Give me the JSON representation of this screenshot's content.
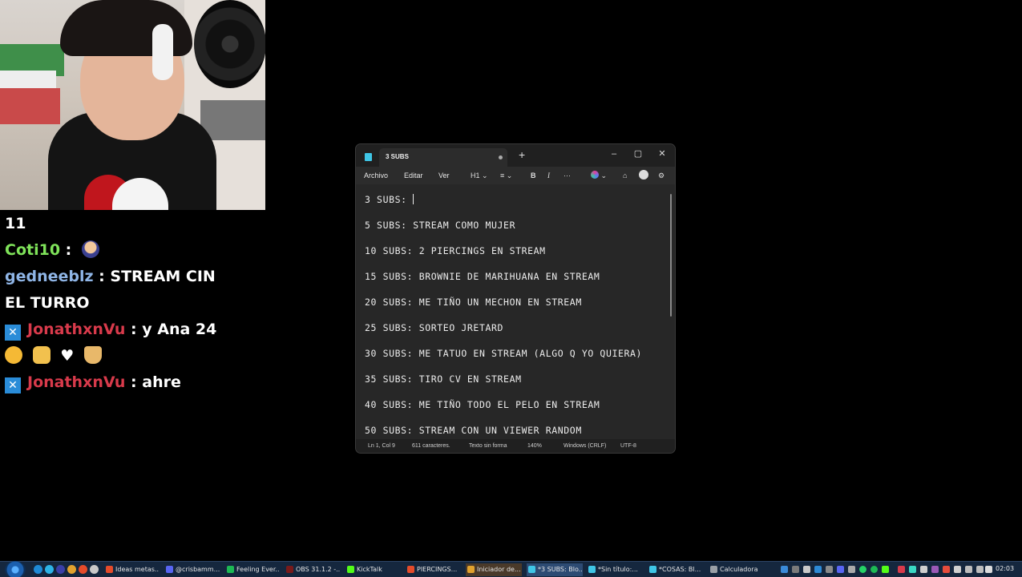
{
  "chat": {
    "lines": [
      {
        "text": "11"
      },
      {
        "user": "Coti10",
        "sep": " :"
      },
      {
        "user": "gedneeblz",
        "sep": " : ",
        "msg": "STREAM CIN",
        "cont": "EL TURRO"
      },
      {
        "user": "JonathxnVu",
        "sep": " : ",
        "msg": "y Ana 24",
        "cont_emoji": "♥"
      },
      {
        "user": "JonathxnVu",
        "sep": " : ",
        "msg": "ahre"
      }
    ]
  },
  "notepad": {
    "tab_title": "3 SUBS",
    "tab_new": "+",
    "window_buttons": {
      "minimize": "–",
      "maximize": "▢",
      "close": "✕"
    },
    "menu": [
      "Archivo",
      "Editar",
      "Ver"
    ],
    "toolbar": {
      "heading": "H1",
      "bold": "B",
      "italic": "I",
      "more": "···"
    },
    "lines": [
      "3 SUBS: ",
      "5 SUBS: STREAM COMO MUJER",
      "10 SUBS: 2 PIERCINGS EN STREAM",
      "15 SUBS: BROWNIE DE MARIHUANA EN STREAM",
      "20 SUBS: ME TIÑO UN MECHON EN STREAM",
      "25 SUBS: SORTEO JRETARD",
      "30 SUBS: ME TATUO EN STREAM (ALGO Q YO QUIERA)",
      "35 SUBS: TIRO CV EN STREAM",
      "40 SUBS: ME TIÑO TODO EL PELO EN STREAM",
      "50 SUBS: STREAM CON UN VIEWER RANDOM"
    ],
    "status": {
      "position": "Ln 1, Col 9",
      "chars": "611 caracteres.",
      "format": "Texto sin forma",
      "zoom": "140%",
      "line_ending": "Windows (CRLF)",
      "encoding": "UTF-8"
    }
  },
  "taskbar": {
    "items": [
      "Ideas metas...",
      "@crisbamm...",
      "Feeling Ever...",
      "OBS 31.1.2 -...",
      "KickTalk",
      "PIERCINGS...",
      "Iniciador de...",
      "*3 SUBS: Blo...",
      "*Sin título:...",
      "*COSAS: Bl...",
      "Calculadora"
    ],
    "clock": "02:03"
  },
  "colors": {
    "background": "#000000",
    "notepad_bg": "#272727",
    "taskbar": "#15273e"
  }
}
